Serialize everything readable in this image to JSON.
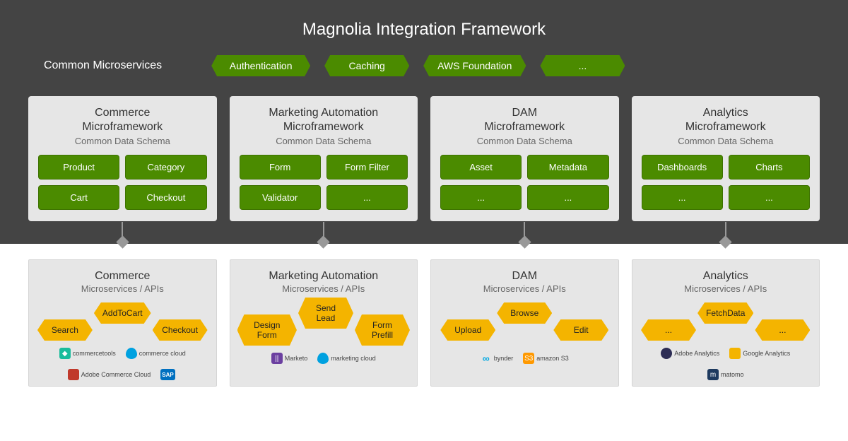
{
  "title": "Magnolia Integration Framework",
  "microservices": {
    "label": "Common Microservices",
    "items": [
      "Authentication",
      "Caching",
      "AWS Foundation",
      "..."
    ]
  },
  "frameworks": [
    {
      "title": "Commerce\nMicroframework",
      "subtitle": "Common Data Schema",
      "chips": [
        "Product",
        "Category",
        "Cart",
        "Checkout"
      ]
    },
    {
      "title": "Marketing Automation\nMicroframework",
      "subtitle": "Common Data Schema",
      "chips": [
        "Form",
        "Form Filter",
        "Validator",
        "..."
      ]
    },
    {
      "title": "DAM\nMicroframework",
      "subtitle": "Common Data Schema",
      "chips": [
        "Asset",
        "Metadata",
        "...",
        "..."
      ]
    },
    {
      "title": "Analytics\nMicroframework",
      "subtitle": "Common Data Schema",
      "chips": [
        "Dashboards",
        "Charts",
        "...",
        "..."
      ]
    }
  ],
  "apis": [
    {
      "title": "Commerce",
      "subtitle": "Microservices / APIs",
      "hex": [
        "Search",
        "AddToCart",
        "Checkout"
      ],
      "logos": [
        {
          "name": "commercetools",
          "glyph": "teal",
          "char": "◆"
        },
        {
          "name": "commerce cloud",
          "glyph": "blue",
          "char": ""
        },
        {
          "name": "Adobe Commerce Cloud",
          "glyph": "red",
          "char": ""
        },
        {
          "name": "SAP",
          "glyph": "sap",
          "char": "SAP"
        }
      ]
    },
    {
      "title": "Marketing Automation",
      "subtitle": "Microservices / APIs",
      "hex": [
        "Design Form",
        "Send Lead",
        "Form Prefill"
      ],
      "logos": [
        {
          "name": "Marketo",
          "glyph": "purple",
          "char": "||"
        },
        {
          "name": "marketing cloud",
          "glyph": "blue",
          "char": ""
        }
      ]
    },
    {
      "title": "DAM",
      "subtitle": "Microservices / APIs",
      "hex": [
        "Upload",
        "Browse",
        "Edit"
      ],
      "logos": [
        {
          "name": "bynder",
          "glyph": "cyan",
          "char": "∞"
        },
        {
          "name": "amazon S3",
          "glyph": "orange",
          "char": "S3"
        }
      ]
    },
    {
      "title": "Analytics",
      "subtitle": "Microservices / APIs",
      "hex": [
        "...",
        "FetchData",
        "..."
      ],
      "logos": [
        {
          "name": "Adobe Analytics",
          "glyph": "dark",
          "char": ""
        },
        {
          "name": "Google Analytics",
          "glyph": "ga",
          "char": ""
        },
        {
          "name": "matomo",
          "glyph": "navy",
          "char": "m"
        }
      ]
    }
  ]
}
